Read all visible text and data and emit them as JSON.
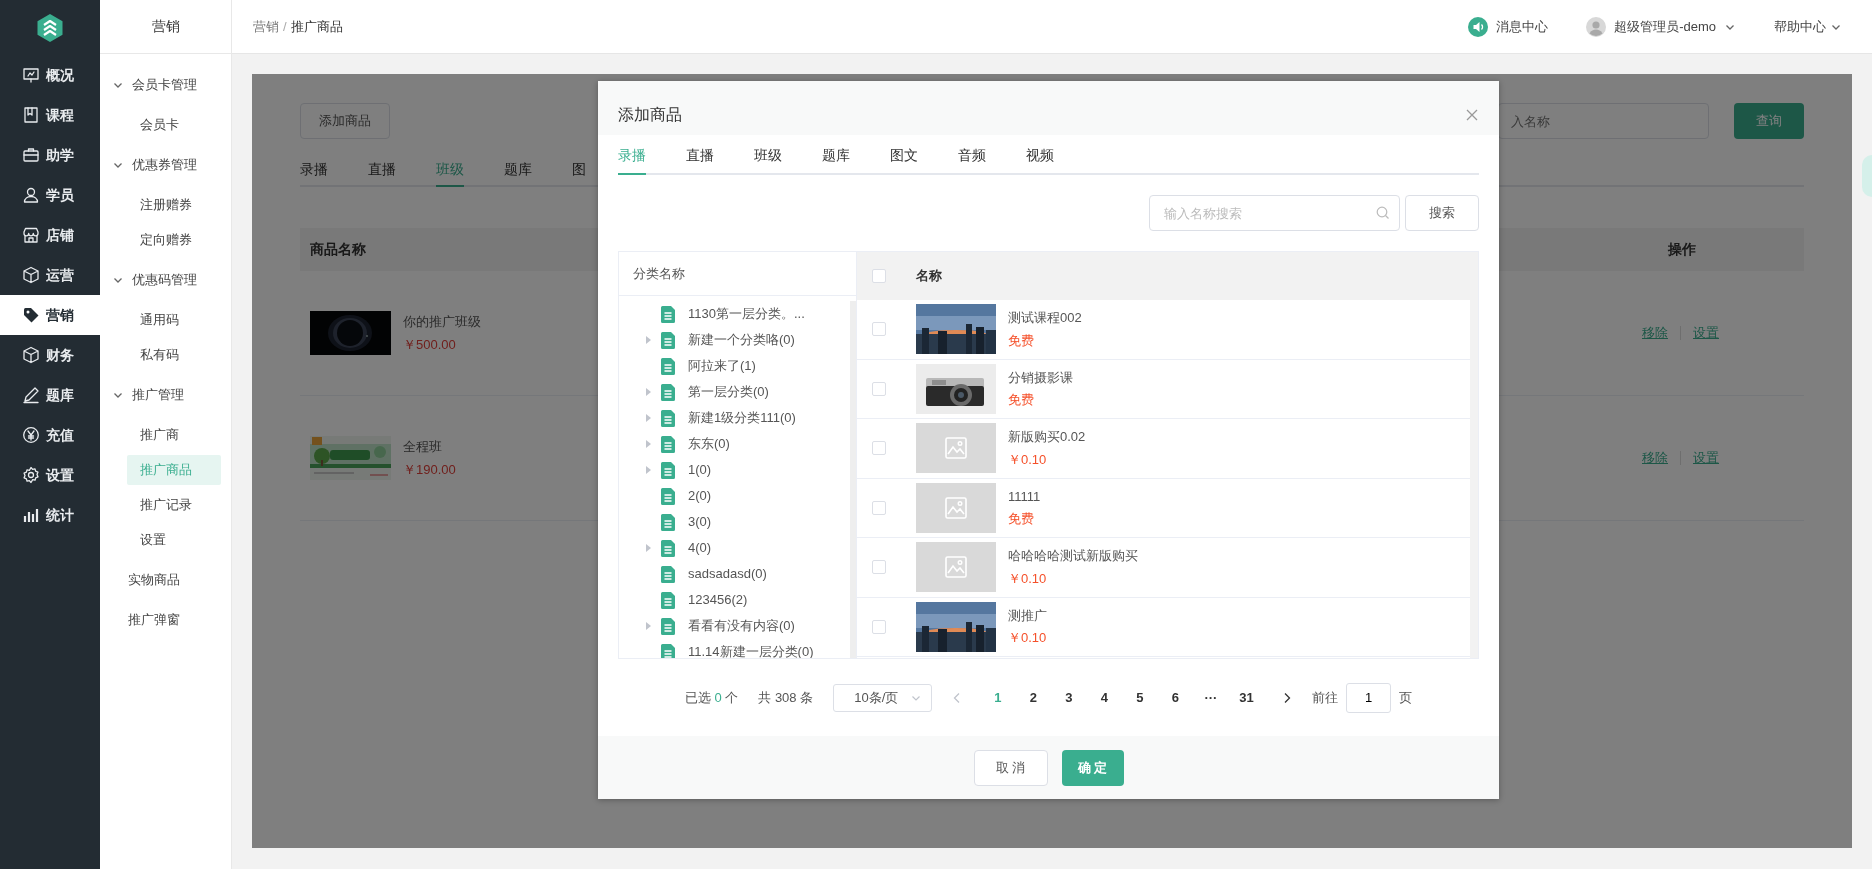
{
  "nav": [
    {
      "label": "概况",
      "selected": false
    },
    {
      "label": "课程",
      "selected": false
    },
    {
      "label": "助学",
      "selected": false
    },
    {
      "label": "学员",
      "selected": false
    },
    {
      "label": "店铺",
      "selected": false
    },
    {
      "label": "运营",
      "selected": false
    },
    {
      "label": "营销",
      "selected": true
    },
    {
      "label": "财务",
      "selected": false
    },
    {
      "label": "题库",
      "selected": false
    },
    {
      "label": "充值",
      "selected": false
    },
    {
      "label": "设置",
      "selected": false
    },
    {
      "label": "统计",
      "selected": false
    }
  ],
  "submenu": {
    "title": "营销",
    "items": [
      {
        "kind": "group",
        "label": "会员卡管理",
        "expanded": true,
        "children": [
          {
            "label": "会员卡",
            "selected": false
          }
        ]
      },
      {
        "kind": "group",
        "label": "优惠券管理",
        "expanded": true,
        "children": [
          {
            "label": "注册赠券",
            "selected": false
          },
          {
            "label": "定向赠券",
            "selected": false
          }
        ]
      },
      {
        "kind": "group",
        "label": "优惠码管理",
        "expanded": true,
        "children": [
          {
            "label": "通用码",
            "selected": false
          },
          {
            "label": "私有码",
            "selected": false
          }
        ]
      },
      {
        "kind": "group",
        "label": "推广管理",
        "expanded": true,
        "children": [
          {
            "label": "推广商",
            "selected": false
          },
          {
            "label": "推广商品",
            "selected": true
          },
          {
            "label": "推广记录",
            "selected": false
          },
          {
            "label": "设置",
            "selected": false
          }
        ]
      },
      {
        "kind": "link",
        "label": "实物商品",
        "selected": false
      },
      {
        "kind": "link",
        "label": "推广弹窗",
        "selected": false
      }
    ]
  },
  "header": {
    "breadcrumb": [
      "营销",
      "推广商品"
    ],
    "separator": "/",
    "messages": "消息中心",
    "user": "超级管理员-demo",
    "help": "帮助中心"
  },
  "page": {
    "add_button": "添加商品",
    "search_placeholder": "入名称",
    "query_button": "查询",
    "tabs": [
      {
        "label": "录播",
        "selected": false
      },
      {
        "label": "直播",
        "selected": false
      },
      {
        "label": "班级",
        "selected": true
      },
      {
        "label": "题库",
        "selected": false
      },
      {
        "label": "图",
        "selected": false
      }
    ],
    "columns": [
      "商品名称",
      "操作"
    ],
    "rows": [
      {
        "name": "你的推广班级",
        "price": "￥500.00",
        "actions": [
          "移除",
          "设置"
        ]
      },
      {
        "name": "全程班",
        "price": "￥190.00",
        "actions": [
          "移除",
          "设置"
        ]
      }
    ]
  },
  "dialog": {
    "title": "添加商品",
    "tabs": [
      {
        "label": "录播",
        "selected": true
      },
      {
        "label": "直播",
        "selected": false
      },
      {
        "label": "班级",
        "selected": false
      },
      {
        "label": "题库",
        "selected": false
      },
      {
        "label": "图文",
        "selected": false
      },
      {
        "label": "音频",
        "selected": false
      },
      {
        "label": "视频",
        "selected": false
      }
    ],
    "search": {
      "placeholder": "输入名称搜索",
      "button": "搜索"
    },
    "tree": {
      "header": "分类名称",
      "items": [
        {
          "label": "1130第一层分类。...",
          "expandable": false
        },
        {
          "label": "新建一个分类咯(0)",
          "expandable": true
        },
        {
          "label": "阿拉来了(1)",
          "expandable": false
        },
        {
          "label": "第一层分类(0)",
          "expandable": true
        },
        {
          "label": "新建1级分类111(0)",
          "expandable": true
        },
        {
          "label": "东东(0)",
          "expandable": true
        },
        {
          "label": "1(0)",
          "expandable": true
        },
        {
          "label": "2(0)",
          "expandable": false
        },
        {
          "label": "3(0)",
          "expandable": false
        },
        {
          "label": "4(0)",
          "expandable": true
        },
        {
          "label": "sadsadasd(0)",
          "expandable": false
        },
        {
          "label": "123456(2)",
          "expandable": false
        },
        {
          "label": "看看有没有内容(0)",
          "expandable": true
        },
        {
          "label": "11.14新建一层分类(0)",
          "expandable": false
        }
      ]
    },
    "list": {
      "header": "名称",
      "all_checked": false,
      "rows": [
        {
          "name": "测试课程002",
          "price": "免费",
          "checked": false
        },
        {
          "name": "分销摄影课",
          "price": "免费",
          "checked": false
        },
        {
          "name": "新版购买0.02",
          "price": "￥0.10",
          "kind": "placeholder",
          "checked": false
        },
        {
          "name": "11111",
          "price": "免费",
          "kind": "placeholder",
          "checked": false
        },
        {
          "name": "哈哈哈哈测试新版购买",
          "price": "￥0.10",
          "kind": "placeholder",
          "checked": false
        },
        {
          "name": "测推广",
          "price": "￥0.10",
          "checked": false
        }
      ]
    },
    "pagination": {
      "selected_label": "已选",
      "selected_count": "0",
      "selected_unit": "个",
      "total": "共 308 条",
      "page_size": "10条/页",
      "prev_disabled": true,
      "next_disabled": false,
      "pages": [
        {
          "label": "1",
          "selected": true
        },
        {
          "label": "2",
          "selected": false
        },
        {
          "label": "3",
          "selected": false
        },
        {
          "label": "4",
          "selected": false
        },
        {
          "label": "5",
          "selected": false
        },
        {
          "label": "6",
          "selected": false
        },
        {
          "label": "···",
          "selected": false
        },
        {
          "label": "31",
          "selected": false
        }
      ],
      "jump_label": "前往",
      "jump_value": "1",
      "jump_unit": "页"
    },
    "buttons": {
      "cancel": "取 消",
      "confirm": "确 定"
    }
  }
}
